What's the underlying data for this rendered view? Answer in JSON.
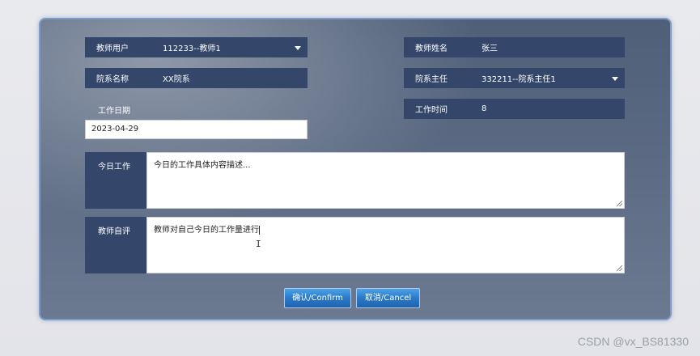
{
  "form": {
    "teacher_user": {
      "label": "教师用户",
      "value": "112233--教师1"
    },
    "teacher_name": {
      "label": "教师姓名",
      "value": "张三"
    },
    "department_name": {
      "label": "院系名称",
      "value": "XX院系"
    },
    "department_head": {
      "label": "院系主任",
      "value": "332211--院系主任1"
    },
    "work_date": {
      "label": "工作日期",
      "value": "2023-04-29"
    },
    "work_time": {
      "label": "工作时间",
      "value": "8"
    },
    "today_work": {
      "label": "今日工作",
      "value": "今日的工作具体内容描述..."
    },
    "self_review": {
      "label": "教师自评",
      "value": "教师对自己今日的工作量进行"
    }
  },
  "buttons": {
    "confirm": "确认/Confirm",
    "cancel": "取消/Cancel"
  },
  "cursor_glyph": "I",
  "watermark": "CSDN @vx_BS81330"
}
